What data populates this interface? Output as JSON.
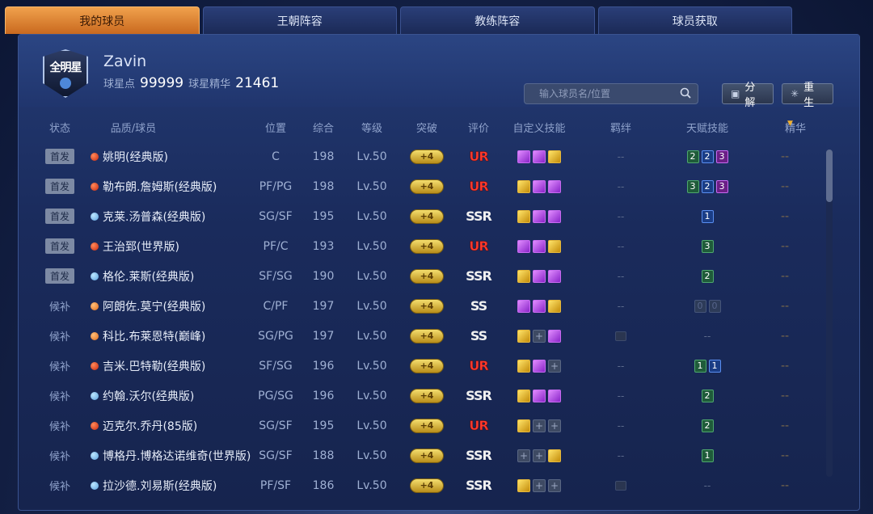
{
  "tabs": [
    {
      "label": "我的球员",
      "active": true
    },
    {
      "label": "王朝阵容",
      "active": false
    },
    {
      "label": "教练阵容",
      "active": false
    },
    {
      "label": "球员获取",
      "active": false
    }
  ],
  "profile": {
    "logo_text": "全明星",
    "username": "Zavin",
    "points_label": "球星点",
    "points_value": "99999",
    "essence_label": "球星精华",
    "essence_value": "21461"
  },
  "search": {
    "placeholder": "输入球员名/位置"
  },
  "buttons": {
    "decompose": "分解",
    "reborn": "重生"
  },
  "columns": {
    "status": "状态",
    "name": "品质/球员",
    "position": "位置",
    "overall": "综合",
    "level": "等级",
    "breakthrough": "突破",
    "rating": "评价",
    "custom_skills": "自定义技能",
    "bond": "羁绊",
    "talent_skills": "天赋技能",
    "essence": "精华"
  },
  "players": [
    {
      "status": "首发",
      "starter": true,
      "quality": "red",
      "name": "姚明(经典版)",
      "position": "C",
      "overall": "198",
      "level": "Lv.50",
      "breakthrough": "+4",
      "rating": "UR",
      "skills": [
        "purple",
        "purple",
        "gold"
      ],
      "bond": "--",
      "talents": [
        {
          "v": "2",
          "c": "green"
        },
        {
          "v": "2",
          "c": "blue"
        },
        {
          "v": "3",
          "c": "purple"
        }
      ],
      "essence": "--"
    },
    {
      "status": "首发",
      "starter": true,
      "quality": "red",
      "name": "勒布朗.詹姆斯(经典版)",
      "position": "PF/PG",
      "overall": "198",
      "level": "Lv.50",
      "breakthrough": "+4",
      "rating": "UR",
      "skills": [
        "gold",
        "purple",
        "purple"
      ],
      "bond": "--",
      "talents": [
        {
          "v": "3",
          "c": "green"
        },
        {
          "v": "2",
          "c": "blue"
        },
        {
          "v": "3",
          "c": "purple"
        }
      ],
      "essence": "--"
    },
    {
      "status": "首发",
      "starter": true,
      "quality": "blue",
      "name": "克莱.汤普森(经典版)",
      "position": "SG/SF",
      "overall": "195",
      "level": "Lv.50",
      "breakthrough": "+4",
      "rating": "SSR",
      "skills": [
        "gold",
        "purple",
        "purple"
      ],
      "bond": "--",
      "talents": [
        {
          "v": "1",
          "c": "blue"
        }
      ],
      "essence": "--"
    },
    {
      "status": "首发",
      "starter": true,
      "quality": "red",
      "name": "王治郅(世界版)",
      "position": "PF/C",
      "overall": "193",
      "level": "Lv.50",
      "breakthrough": "+4",
      "rating": "UR",
      "skills": [
        "purple",
        "purple",
        "gold"
      ],
      "bond": "--",
      "talents": [
        {
          "v": "3",
          "c": "green"
        }
      ],
      "essence": "--"
    },
    {
      "status": "首发",
      "starter": true,
      "quality": "blue",
      "name": "格伦.莱斯(经典版)",
      "position": "SF/SG",
      "overall": "190",
      "level": "Lv.50",
      "breakthrough": "+4",
      "rating": "SSR",
      "skills": [
        "gold",
        "purple",
        "purple"
      ],
      "bond": "--",
      "talents": [
        {
          "v": "2",
          "c": "green"
        }
      ],
      "essence": "--"
    },
    {
      "status": "候补",
      "starter": false,
      "quality": "orange",
      "name": "阿朗佐.莫宁(经典版)",
      "position": "C/PF",
      "overall": "197",
      "level": "Lv.50",
      "breakthrough": "+4",
      "rating": "SS",
      "skills": [
        "purple",
        "purple",
        "gold"
      ],
      "bond": "--",
      "talents": [
        {
          "v": "0",
          "c": "empty"
        },
        {
          "v": "0",
          "c": "empty"
        }
      ],
      "essence": "--"
    },
    {
      "status": "候补",
      "starter": false,
      "quality": "orange",
      "name": "科比.布莱恩特(巅峰)",
      "position": "SG/PG",
      "overall": "197",
      "level": "Lv.50",
      "breakthrough": "+4",
      "rating": "SS",
      "skills": [
        "gold",
        "empty",
        "purple"
      ],
      "bond": "icon",
      "talents": [],
      "talent_text": "--",
      "essence": "--"
    },
    {
      "status": "候补",
      "starter": false,
      "quality": "red",
      "name": "吉米.巴特勒(经典版)",
      "position": "SF/SG",
      "overall": "196",
      "level": "Lv.50",
      "breakthrough": "+4",
      "rating": "UR",
      "skills": [
        "gold",
        "purple",
        "empty"
      ],
      "bond": "--",
      "talents": [
        {
          "v": "1",
          "c": "green"
        },
        {
          "v": "1",
          "c": "blue"
        }
      ],
      "essence": "--"
    },
    {
      "status": "候补",
      "starter": false,
      "quality": "blue",
      "name": "约翰.沃尔(经典版)",
      "position": "PG/SG",
      "overall": "196",
      "level": "Lv.50",
      "breakthrough": "+4",
      "rating": "SSR",
      "skills": [
        "gold",
        "purple",
        "purple"
      ],
      "bond": "--",
      "talents": [
        {
          "v": "2",
          "c": "green"
        }
      ],
      "essence": "--"
    },
    {
      "status": "候补",
      "starter": false,
      "quality": "red",
      "name": "迈克尔.乔丹(85版)",
      "position": "SG/SF",
      "overall": "195",
      "level": "Lv.50",
      "breakthrough": "+4",
      "rating": "UR",
      "skills": [
        "gold",
        "empty",
        "empty"
      ],
      "bond": "--",
      "talents": [
        {
          "v": "2",
          "c": "green"
        }
      ],
      "essence": "--"
    },
    {
      "status": "候补",
      "starter": false,
      "quality": "blue",
      "name": "博格丹.博格达诺维奇(世界版)",
      "position": "SG/SF",
      "overall": "188",
      "level": "Lv.50",
      "breakthrough": "+4",
      "rating": "SSR",
      "skills": [
        "empty",
        "empty",
        "gold"
      ],
      "bond": "--",
      "talents": [
        {
          "v": "1",
          "c": "green"
        }
      ],
      "essence": "--"
    },
    {
      "status": "候补",
      "starter": false,
      "quality": "blue",
      "name": "拉沙德.刘易斯(经典版)",
      "position": "PF/SF",
      "overall": "186",
      "level": "Lv.50",
      "breakthrough": "+4",
      "rating": "SSR",
      "skills": [
        "gold",
        "empty",
        "empty"
      ],
      "bond": "icon",
      "talents": [],
      "talent_text": "--",
      "essence": "--"
    }
  ]
}
